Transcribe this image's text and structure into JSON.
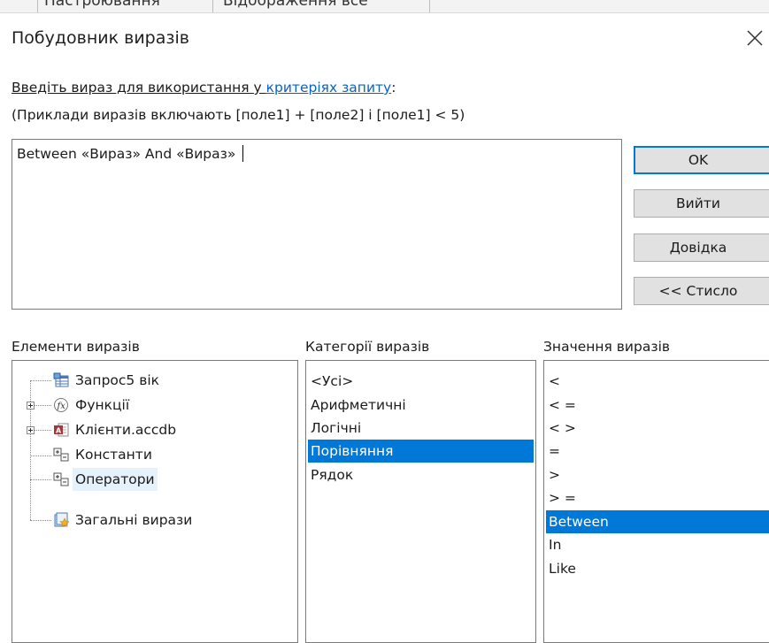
{
  "background_tabs": [
    "Настроювання",
    "Відображення все"
  ],
  "dialog": {
    "title": "Побудовник виразів",
    "instruction_prefix": "Введіть вираз для використання у ",
    "instruction_link": "критеріях запиту",
    "instruction_suffix": ":",
    "examples": "(Приклади виразів включають [поле1] + [поле2] і [поле1] < 5)",
    "expression_value": "Between «Вираз» And «Вираз» "
  },
  "buttons": {
    "ok": "OK",
    "exit": "Вийти",
    "help": "Довідка",
    "less": "<< Стисло"
  },
  "panels": {
    "elements_label": "Елементи виразів",
    "categories_label": "Категорії виразів",
    "values_label": "Значення виразів"
  },
  "elements": [
    {
      "label": "Запрос5 вік",
      "icon": "query-icon"
    },
    {
      "label": "Функції",
      "icon": "function-icon"
    },
    {
      "label": "Клієнти.accdb",
      "icon": "access-database-icon"
    },
    {
      "label": "Константи",
      "icon": "constants-icon"
    },
    {
      "label": "Оператори",
      "icon": "operators-icon"
    },
    {
      "label": "Загальні вирази",
      "icon": "common-expressions-icon"
    }
  ],
  "selected_element": "Оператори",
  "categories": [
    "<Усі>",
    "Арифметичні",
    "Логічні",
    "Порівняння",
    "Рядок"
  ],
  "selected_category": "Порівняння",
  "values": [
    "<",
    "< =",
    "< >",
    "=",
    ">",
    "> =",
    "Between",
    "In",
    "Like"
  ],
  "selected_value": "Between",
  "colors": {
    "selection": "#0078d7",
    "link": "#0a62c8",
    "button_face": "#e1e1e1",
    "default_button_border": "#0078d7"
  }
}
